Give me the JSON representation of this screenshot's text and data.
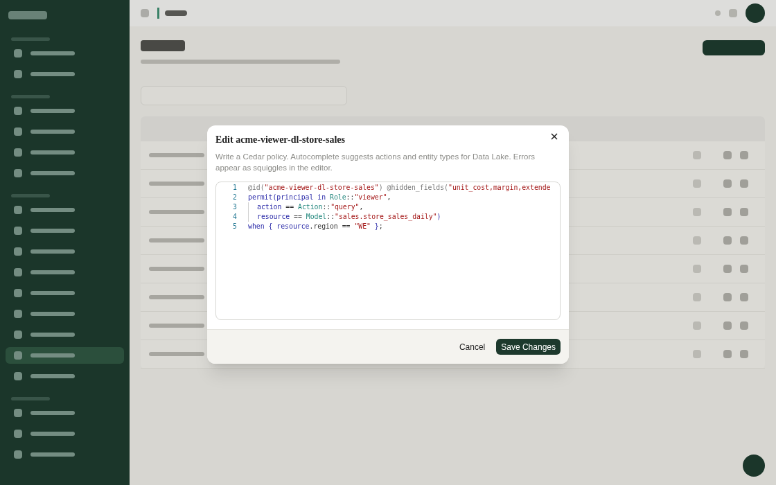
{
  "sidebar": {
    "items": [
      {
        "kind": "heading"
      },
      {
        "kind": "item",
        "selected": false
      },
      {
        "kind": "item",
        "selected": false
      },
      {
        "kind": "heading"
      },
      {
        "kind": "item",
        "selected": false
      },
      {
        "kind": "item",
        "selected": false
      },
      {
        "kind": "item",
        "selected": false
      },
      {
        "kind": "item",
        "selected": false
      },
      {
        "kind": "heading"
      },
      {
        "kind": "item",
        "selected": false
      },
      {
        "kind": "item",
        "selected": false
      },
      {
        "kind": "item",
        "selected": false
      },
      {
        "kind": "item",
        "selected": false
      },
      {
        "kind": "item",
        "selected": false
      },
      {
        "kind": "item",
        "selected": false
      },
      {
        "kind": "item",
        "selected": false
      },
      {
        "kind": "item",
        "selected": true
      },
      {
        "kind": "item",
        "selected": false
      },
      {
        "kind": "heading"
      },
      {
        "kind": "item",
        "selected": false
      },
      {
        "kind": "item",
        "selected": false
      },
      {
        "kind": "item",
        "selected": false
      }
    ]
  },
  "dialog": {
    "title": "Edit acme-viewer-dl-store-sales",
    "description": "Write a Cedar policy. Autocomplete suggests actions and entity types for Data Lake. Errors appear as squiggles in the editor.",
    "editor": {
      "lines": [
        {
          "number": "1",
          "indent": false,
          "tokens": [
            {
              "kind": "decorator",
              "text": "@id("
            },
            {
              "kind": "string",
              "text": "\"acme-viewer-dl-store-sales\""
            },
            {
              "kind": "decorator",
              "text": ") @hidden_fields("
            },
            {
              "kind": "string",
              "text": "\"unit_cost,margin,extende"
            }
          ]
        },
        {
          "number": "2",
          "indent": false,
          "tokens": [
            {
              "kind": "keyword",
              "text": "permit("
            },
            {
              "kind": "keyword",
              "text": "principal"
            },
            {
              "kind": "keyword",
              "text": " in "
            },
            {
              "kind": "type",
              "text": "Role"
            },
            {
              "kind": "plain",
              "text": "::"
            },
            {
              "kind": "string",
              "text": "\"viewer\""
            },
            {
              "kind": "plain",
              "text": ","
            }
          ]
        },
        {
          "number": "3",
          "indent": true,
          "tokens": [
            {
              "kind": "keyword",
              "text": "action"
            },
            {
              "kind": "plain",
              "text": " == "
            },
            {
              "kind": "type",
              "text": "Action"
            },
            {
              "kind": "plain",
              "text": "::"
            },
            {
              "kind": "string",
              "text": "\"query\""
            },
            {
              "kind": "plain",
              "text": ","
            }
          ]
        },
        {
          "number": "4",
          "indent": true,
          "tokens": [
            {
              "kind": "keyword",
              "text": "resource"
            },
            {
              "kind": "plain",
              "text": " == "
            },
            {
              "kind": "type",
              "text": "Model"
            },
            {
              "kind": "plain",
              "text": "::"
            },
            {
              "kind": "string",
              "text": "\"sales.store_sales_daily\""
            },
            {
              "kind": "keyword",
              "text": ")"
            }
          ]
        },
        {
          "number": "5",
          "indent": false,
          "tokens": [
            {
              "kind": "keyword",
              "text": "when { resource"
            },
            {
              "kind": "plain",
              "text": ".region == "
            },
            {
              "kind": "string",
              "text": "\"WE\""
            },
            {
              "kind": "keyword",
              "text": " }"
            },
            {
              "kind": "plain",
              "text": ";"
            }
          ]
        }
      ]
    },
    "buttons": [
      {
        "kind": "secondary",
        "label": "Cancel"
      },
      {
        "kind": "primary",
        "label": "Save Changes"
      }
    ]
  }
}
